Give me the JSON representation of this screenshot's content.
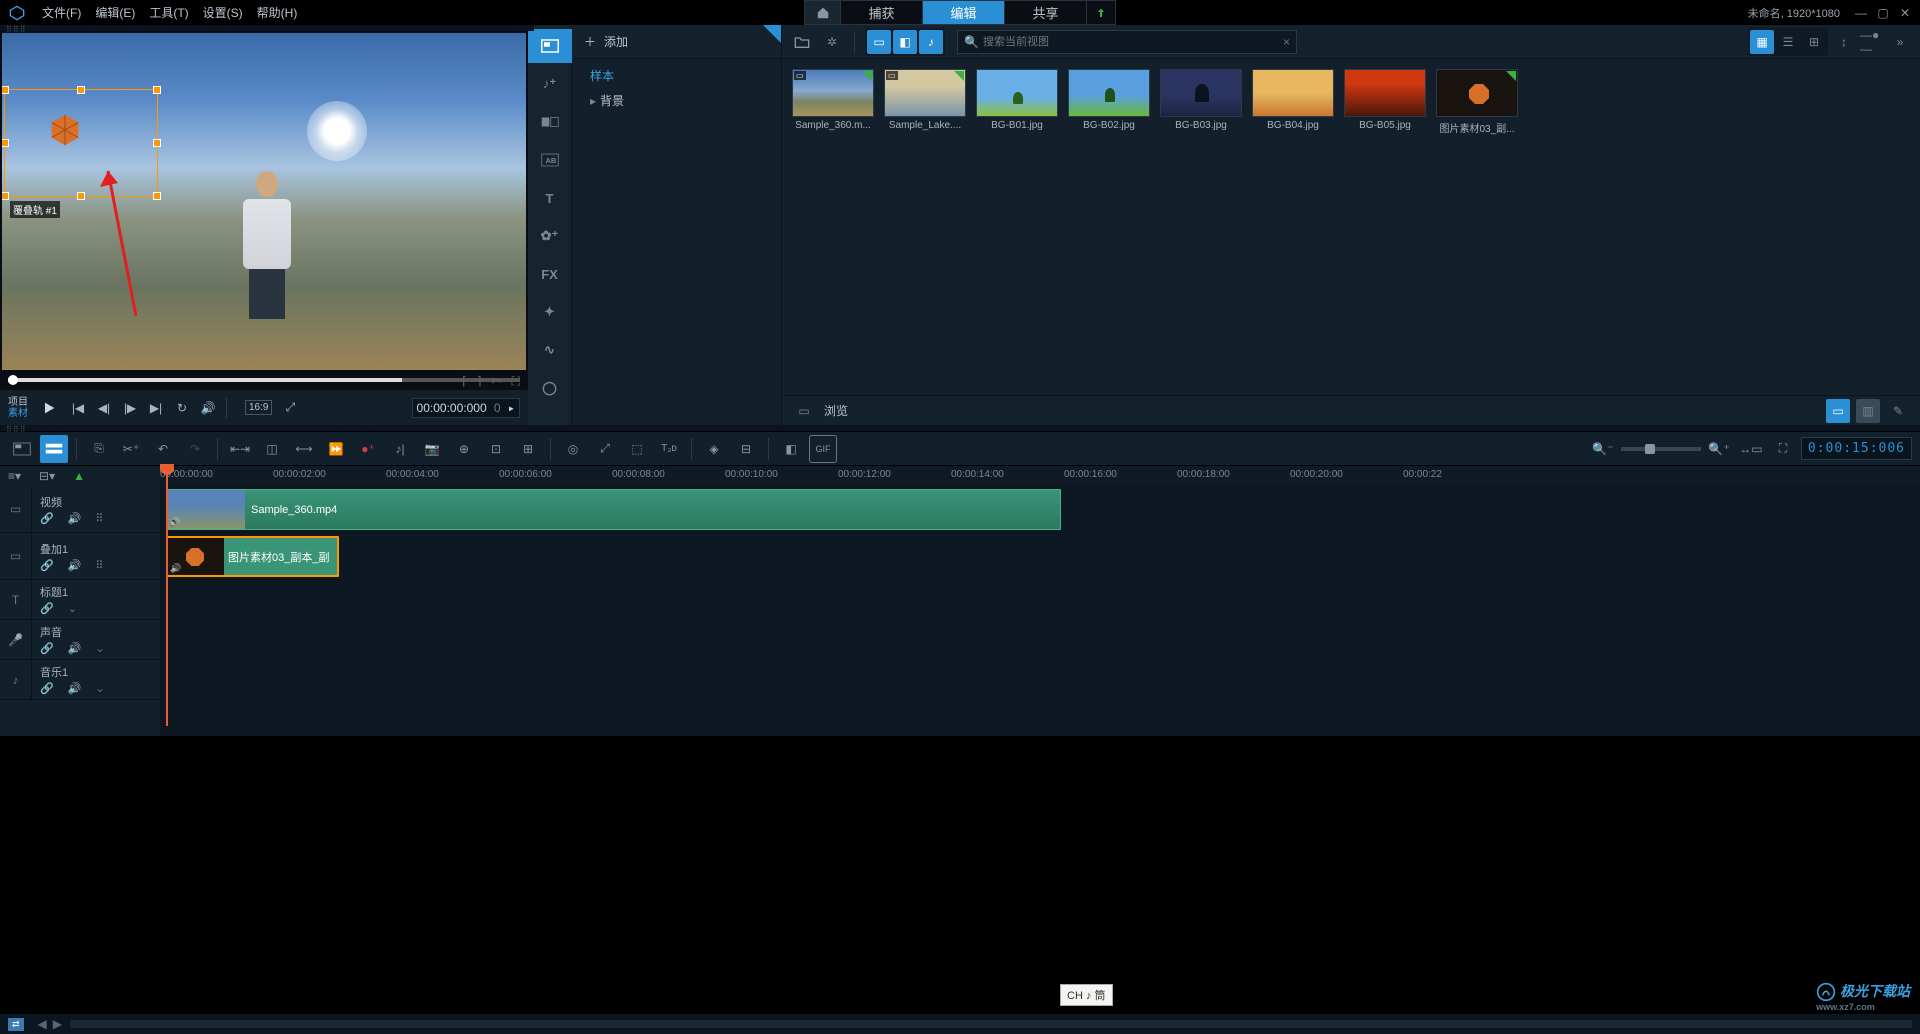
{
  "project": {
    "title": "未命名",
    "resolution": "1920*1080"
  },
  "menu": {
    "file": "文件(F)",
    "edit": "编辑(E)",
    "tools": "工具(T)",
    "settings": "设置(S)",
    "help": "帮助(H)"
  },
  "tabs": {
    "capture": "捕获",
    "edit": "编辑",
    "share": "共享"
  },
  "preview": {
    "track_overlay_label": "覆叠轨 #1",
    "labels": {
      "project": "项目",
      "source": "素材"
    },
    "aspect": "16:9",
    "timecode": "00:00:00:000",
    "frame": "0"
  },
  "library": {
    "add": "添加",
    "tree": {
      "samples": "样本",
      "background": "背景"
    },
    "search_placeholder": "搜索当前视图",
    "browse": "浏览",
    "items": [
      {
        "name": "Sample_360.m...",
        "cls": "t360",
        "badge": "▭"
      },
      {
        "name": "Sample_Lake....",
        "cls": "tlake",
        "badge": "▭"
      },
      {
        "name": "BG-B01.jpg",
        "cls": "tb01",
        "badge": ""
      },
      {
        "name": "BG-B02.jpg",
        "cls": "tb02",
        "badge": ""
      },
      {
        "name": "BG-B03.jpg",
        "cls": "tb03",
        "badge": ""
      },
      {
        "name": "BG-B04.jpg",
        "cls": "tb04",
        "badge": ""
      },
      {
        "name": "BG-B05.jpg",
        "cls": "tb05",
        "badge": ""
      },
      {
        "name": "图片素材03_副...",
        "cls": "tcustom",
        "badge": ""
      }
    ]
  },
  "timeline": {
    "timecode": "0:00:15:006",
    "ticks": [
      "00:00:00:00",
      "00:00:02:00",
      "00:00:04:00",
      "00:00:06:00",
      "00:00:08:00",
      "00:00:10:00",
      "00:00:12:00",
      "00:00:14:00",
      "00:00:16:00",
      "00:00:18:00",
      "00:00:20:00",
      "00:00:22"
    ],
    "tracks": {
      "video": {
        "label": "视频",
        "clip": "Sample_360.mp4"
      },
      "overlay": {
        "label": "叠加1",
        "clip": "图片素材03_副本_副"
      },
      "title": {
        "label": "标题1"
      },
      "voice": {
        "label": "声音"
      },
      "music": {
        "label": "音乐1"
      }
    }
  },
  "ime": "CH ♪ 筒",
  "watermark": {
    "main": "极光下载站",
    "sub": "www.xz7.com"
  }
}
